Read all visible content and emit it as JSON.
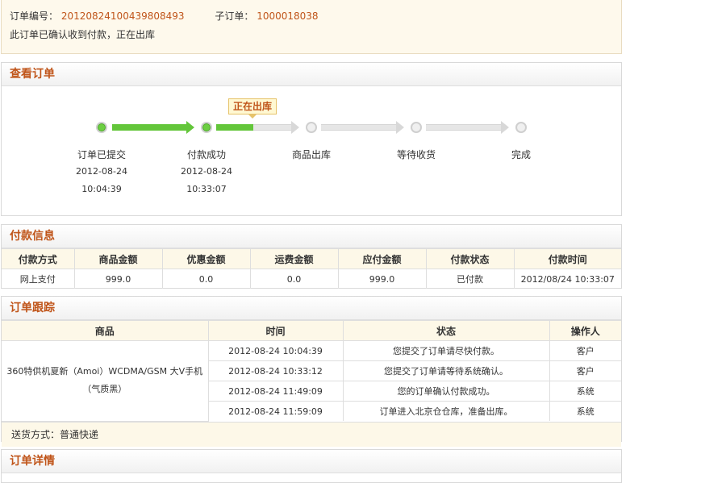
{
  "order": {
    "number_label": "订单编号：",
    "number": "20120824100439808493",
    "sub_label": "子订单：",
    "sub_number": "1000018038",
    "status_message": "此订单已确认收到付款，正在出库"
  },
  "view_order": {
    "title": "查看订单",
    "current_tip": "正在出库",
    "steps": [
      {
        "label": "订单已提交",
        "date": "2012-08-24",
        "time": "10:04:39",
        "done": true
      },
      {
        "label": "付款成功",
        "date": "2012-08-24",
        "time": "10:33:07",
        "done": true
      },
      {
        "label": "商品出库",
        "date": "",
        "time": "",
        "done": false
      },
      {
        "label": "等待收货",
        "date": "",
        "time": "",
        "done": false
      },
      {
        "label": "完成",
        "date": "",
        "time": "",
        "done": false
      }
    ],
    "progress_to_third": 0.33
  },
  "payment": {
    "title": "付款信息",
    "headers": [
      "付款方式",
      "商品金额",
      "优惠金额",
      "运费金额",
      "应付金额",
      "付款状态",
      "付款时间"
    ],
    "row": [
      "网上支付",
      "999.0",
      "0.0",
      "0.0",
      "999.0",
      "已付款",
      "2012/08/24 10:33:07"
    ]
  },
  "tracking": {
    "title": "订单跟踪",
    "headers": [
      "商品",
      "时间",
      "状态",
      "操作人"
    ],
    "product": "360特供机夏新（Amoi）WCDMA/GSM 大V手机（气质黑）",
    "rows": [
      {
        "time": "2012-08-24 10:04:39",
        "status": "您提交了订单请尽快付款。",
        "operator": "客户"
      },
      {
        "time": "2012-08-24 10:33:12",
        "status": "您提交了订单请等待系统确认。",
        "operator": "客户"
      },
      {
        "time": "2012-08-24 11:49:09",
        "status": "您的订单确认付款成功。",
        "operator": "系统"
      },
      {
        "time": "2012-08-24 11:59:09",
        "status": "订单进入北京仓仓库，准备出库。",
        "operator": "系统"
      }
    ],
    "shipping": "送货方式：普通快递"
  },
  "details": {
    "title": "订单详情"
  }
}
